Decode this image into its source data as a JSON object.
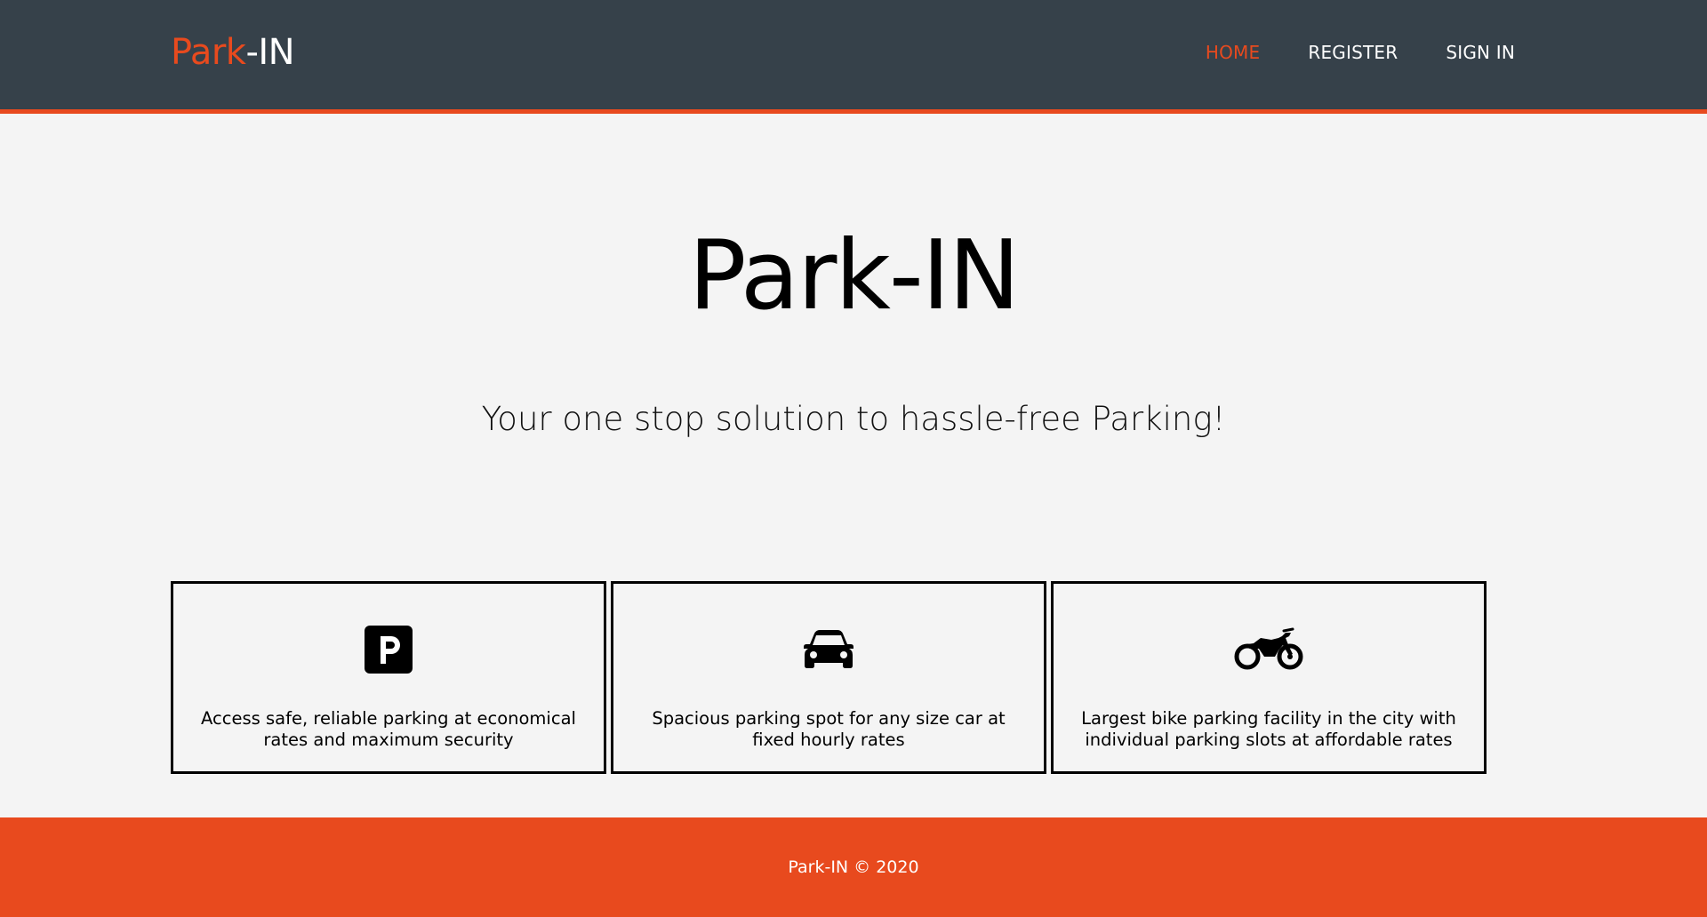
{
  "header": {
    "logo_accent": "Park",
    "logo_rest": "-IN",
    "nav": [
      {
        "label": "HOME",
        "active": true
      },
      {
        "label": "REGISTER",
        "active": false
      },
      {
        "label": "SIGN IN",
        "active": false
      }
    ]
  },
  "hero": {
    "title": "Park-IN",
    "subtitle": "Your one stop solution to hassle-free Parking!"
  },
  "features": [
    {
      "icon": "parking-icon",
      "text": "Access safe, reliable parking at economical rates and maximum security"
    },
    {
      "icon": "car-icon",
      "text": "Spacious parking spot for any size car at fixed hourly rates"
    },
    {
      "icon": "motorcycle-icon",
      "text": "Largest bike parking facility in the city with individual parking slots at affordable rates"
    }
  ],
  "footer": {
    "text": "Park-IN © 2020"
  },
  "colors": {
    "header_bg": "#36414a",
    "accent": "#e84a1e",
    "page_bg": "#f4f4f4"
  }
}
